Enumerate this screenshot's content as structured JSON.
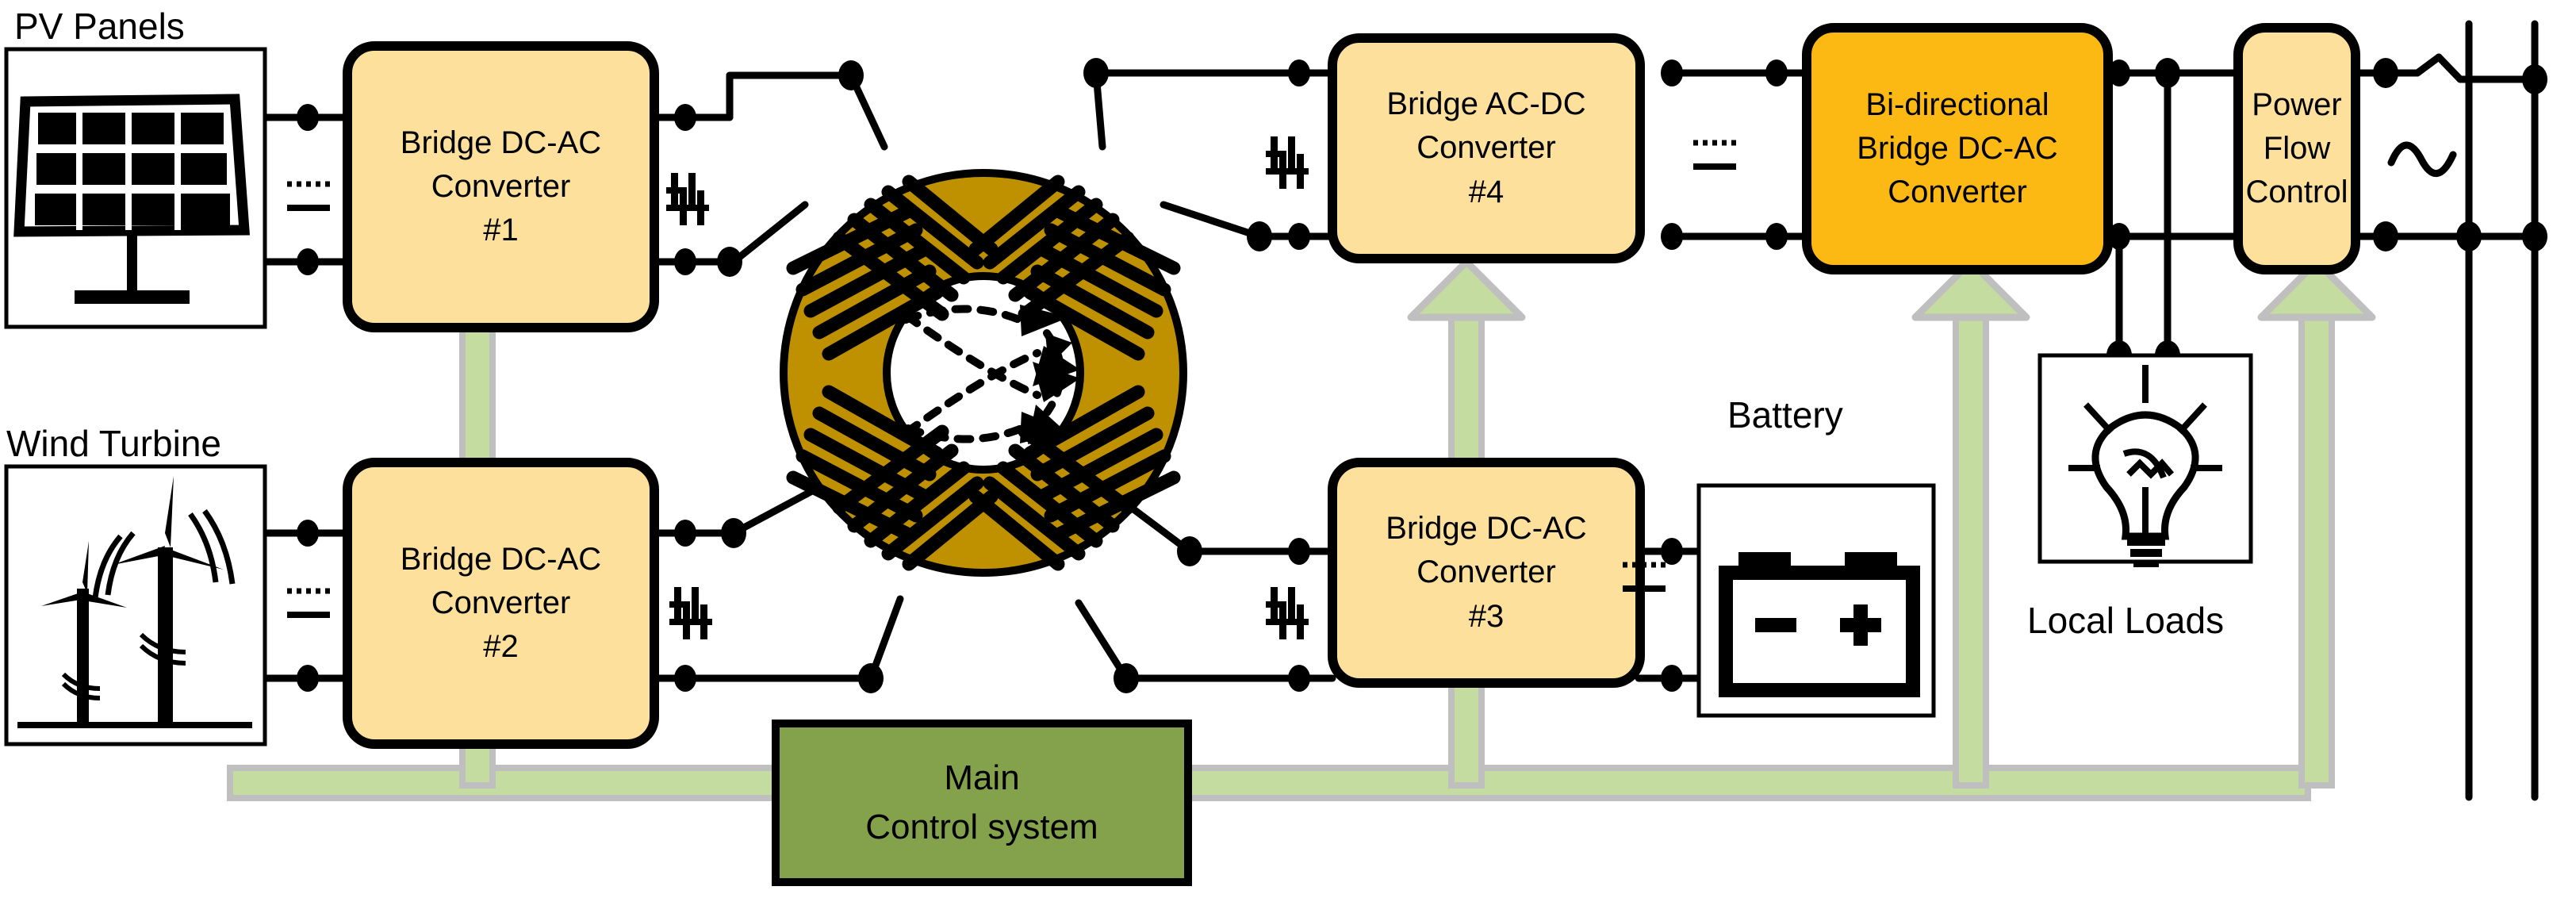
{
  "diagram": {
    "title_present": false,
    "colors": {
      "converter_fill": "#FCE09B",
      "bidirectional_fill": "#FDB913",
      "block_stroke": "#000000",
      "core_fill": "#BF9000",
      "control_fill": "#83A24B",
      "control_bus": "#C5DCA0",
      "control_bus_edge": "#BFBFBF",
      "wire": "#000000",
      "panel_stroke": "#000000"
    },
    "sources": [
      {
        "id": "pv",
        "label": "PV Panels",
        "icon": "solar-panel-icon",
        "port_type": "dc"
      },
      {
        "id": "wind",
        "label": "Wind Turbine",
        "icon": "wind-turbine-icon",
        "port_type": "dc"
      }
    ],
    "converters": [
      {
        "id": "conv1",
        "line1": "Bridge DC-AC",
        "line2": "Converter",
        "line3": "#1",
        "fill": "#FCE09B",
        "in": "dc",
        "out": "ac3"
      },
      {
        "id": "conv2",
        "line1": "Bridge DC-AC",
        "line2": "Converter",
        "line3": "#2",
        "fill": "#FCE09B",
        "in": "dc",
        "out": "ac3"
      },
      {
        "id": "conv3",
        "line1": "Bridge DC-AC",
        "line2": "Converter",
        "line3": "#3",
        "fill": "#FCE09B",
        "in": "ac3",
        "out": "dc"
      },
      {
        "id": "conv4",
        "line1": "Bridge AC-DC",
        "line2": "Converter",
        "line3": "#4",
        "fill": "#FCE09B",
        "in": "ac3",
        "out": "dc"
      },
      {
        "id": "bidir",
        "line1": "Bi-directional",
        "line2": "Bridge DC-AC",
        "line3": "Converter",
        "fill": "#FDB913",
        "in": "dc",
        "out": "ac"
      },
      {
        "id": "pfc",
        "line1": "Power",
        "line2": "Flow",
        "line3": "Control",
        "fill": "#FCE09B",
        "in": "ac",
        "out": "grid"
      }
    ],
    "core": {
      "id": "multi-winding-transformer",
      "type": "toroidal-magnetic-core",
      "fill": "#BF9000",
      "winding_groups": 4,
      "flux_arrows": 6
    },
    "storage": {
      "id": "battery",
      "label": "Battery",
      "icon": "battery-icon",
      "port_type": "dc"
    },
    "loads": {
      "id": "local-loads",
      "label": "Local Loads",
      "icon": "lightbulb-icon"
    },
    "grid": {
      "id": "utility-grid",
      "icon": "ac-source-icon",
      "bus_lines": 2
    },
    "control": {
      "id": "main-control-system",
      "line1": "Main",
      "line2": "Control system",
      "fill": "#83A24B",
      "bus_color": "#C5DCA0",
      "arrow_targets": [
        "conv1",
        "conv2",
        "conv3",
        "conv4",
        "bidir",
        "pfc"
      ]
    },
    "port_markers": {
      "dc_symbol": "dashed-line-over-solid-line",
      "ac3_symbol": "three-phase-bars",
      "ac_symbol": "sine-wave"
    }
  }
}
